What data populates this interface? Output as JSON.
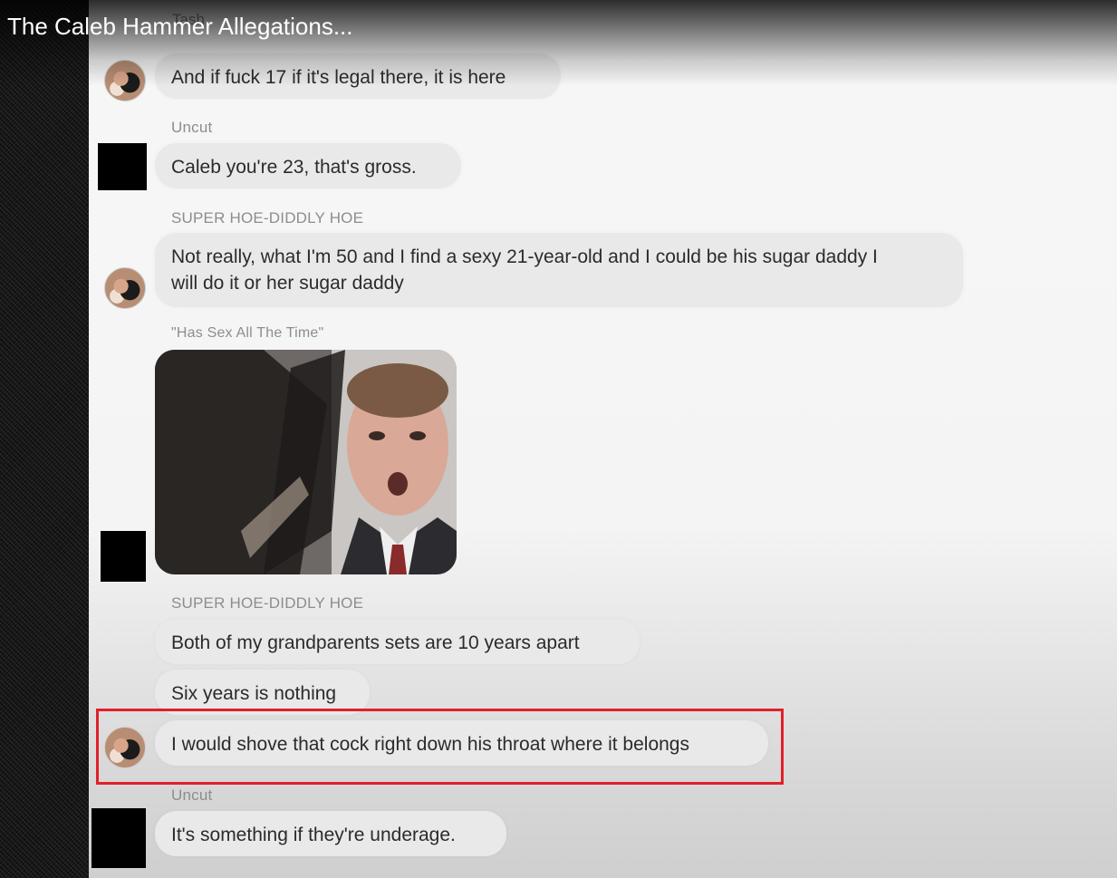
{
  "video": {
    "title": "The Caleb Hammer Allegations..."
  },
  "chat": {
    "faded_top_label": "Tash",
    "messages": [
      {
        "sender": "",
        "text": "And if fuck 17 if it's legal there, it is here",
        "avatar": "photo-avatar"
      },
      {
        "sender": "Uncut",
        "text": "Caleb you're 23, that's gross.",
        "avatar": "black-square-avatar"
      },
      {
        "sender": "SUPER HOE-DIDDLY HOE",
        "text": "Not really, what I'm 50 and I find a sexy 21-year-old and I could be his sugar daddy I will do it or her sugar daddy",
        "avatar": "photo-avatar"
      },
      {
        "sender": "\"Has Sex All The Time\"",
        "text": "",
        "attachment": "gif-image",
        "avatar": "black-square-avatar"
      },
      {
        "sender": "SUPER HOE-DIDDLY HOE",
        "text": "Both of my grandparents sets are 10 years apart",
        "avatar": ""
      },
      {
        "sender": "",
        "text": "Six years is nothing",
        "avatar": ""
      },
      {
        "sender": "",
        "text": "I would shove that cock right down his throat where it belongs",
        "avatar": "photo-avatar",
        "highlighted": true
      },
      {
        "sender": "Uncut",
        "text": "It's something if they're underage.",
        "avatar": "black-square-avatar"
      }
    ]
  },
  "colors": {
    "highlight_border": "#e0202a",
    "bubble_bg": "#e9e9e9",
    "sender_label": "#8d8d8d"
  }
}
